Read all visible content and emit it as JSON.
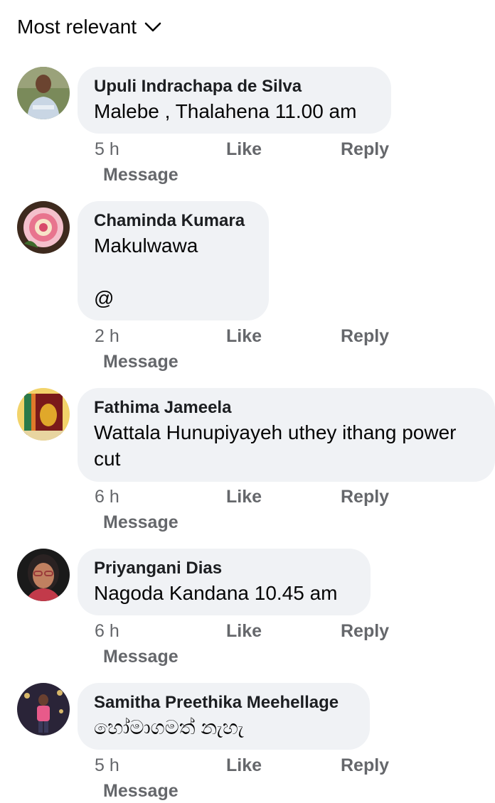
{
  "sort": {
    "label": "Most relevant"
  },
  "actions": {
    "like": "Like",
    "reply": "Reply",
    "message": "Message"
  },
  "comments": [
    {
      "author": "Upuli Indrachapa de Silva",
      "text": "Malebe , Thalahena 11.00 am",
      "time": "5 h"
    },
    {
      "author": "Chaminda Kumara",
      "text": "Makulwawa\n\n@",
      "time": "2 h"
    },
    {
      "author": "Fathima Jameela",
      "text": "Wattala Hunupiyayeh uthey ithang power\ncut",
      "time": "6 h"
    },
    {
      "author": "Priyangani Dias",
      "text": "Nagoda Kandana 10.45 am",
      "time": "6 h"
    },
    {
      "author": "Samitha Preethika Meehellage",
      "text": "හෝමාගමත් නැහැ",
      "time": "5 h"
    }
  ],
  "colors": {
    "bubble": "#f0f2f5",
    "meta": "#65676b",
    "author": "#1c1e21"
  }
}
